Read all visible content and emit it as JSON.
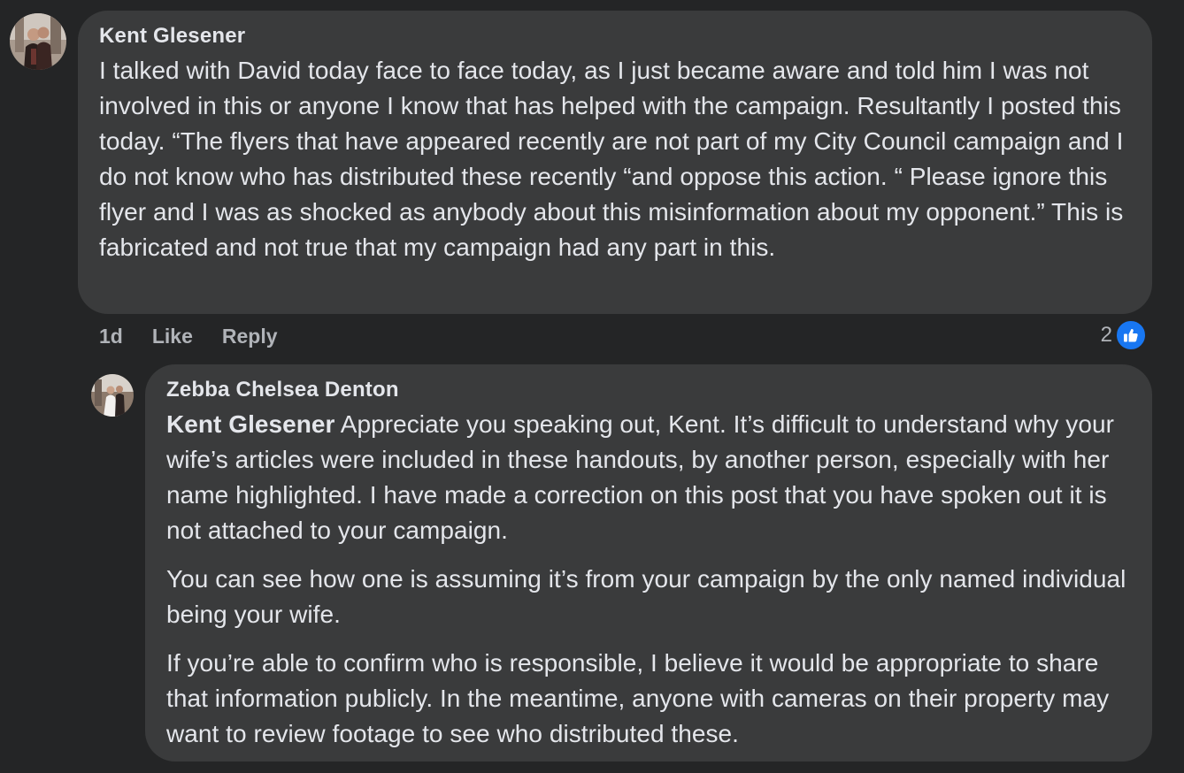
{
  "comment": {
    "author": "Kent Glesener",
    "text": "I talked with David today face to face today, as I just became aware and told him I was not involved in this or anyone I know that has helped with the campaign. Resultantly I posted this today. “The flyers that have appeared recently are not part of my City Council campaign and I do not know who has distributed these recently “and oppose this action. “ Please ignore this flyer and I was as shocked as anybody about this misinformation about my opponent.” This is fabricated and not true that my campaign had any part in this.",
    "timestamp": "1d",
    "like_label": "Like",
    "reply_label": "Reply",
    "reaction_count": "2",
    "reaction_icon": "thumbs-up-icon"
  },
  "reply": {
    "author": "Zebba Chelsea Denton",
    "mention": "Kent Glesener",
    "paragraphs": [
      " Appreciate you speaking out, Kent. It’s difficult to understand why your wife’s articles were included in these handouts, by another person, especially with her name highlighted. I have made a correction on this post that you have spoken out it is not attached to your campaign.",
      "You can see how one is assuming it’s from your campaign by the only named individual being your wife.",
      "If you’re able to confirm who is responsible, I believe it would be appropriate to share that information publicly. In the meantime, anyone with cameras on their property may want to review footage to see who distributed these."
    ]
  },
  "colors": {
    "background": "#242526",
    "bubble": "#3a3b3c",
    "text_primary": "#e4e6eb",
    "text_secondary": "#b0b3b8",
    "like_blue": "#1877f2"
  }
}
